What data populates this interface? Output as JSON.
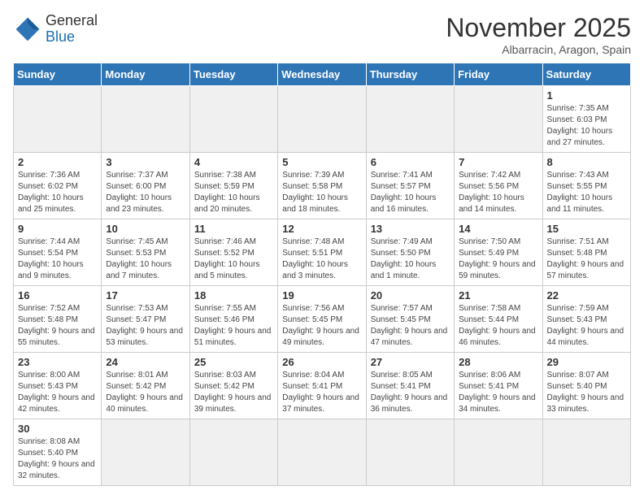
{
  "header": {
    "logo_general": "General",
    "logo_blue": "Blue",
    "month_title": "November 2025",
    "location": "Albarracin, Aragon, Spain"
  },
  "days": [
    "Sunday",
    "Monday",
    "Tuesday",
    "Wednesday",
    "Thursday",
    "Friday",
    "Saturday"
  ],
  "weeks": [
    [
      {
        "date": "",
        "info": "",
        "empty": true
      },
      {
        "date": "",
        "info": "",
        "empty": true
      },
      {
        "date": "",
        "info": "",
        "empty": true
      },
      {
        "date": "",
        "info": "",
        "empty": true
      },
      {
        "date": "",
        "info": "",
        "empty": true
      },
      {
        "date": "",
        "info": "",
        "empty": true
      },
      {
        "date": "1",
        "info": "Sunrise: 7:35 AM\nSunset: 6:03 PM\nDaylight: 10 hours and 27 minutes."
      }
    ],
    [
      {
        "date": "2",
        "info": "Sunrise: 7:36 AM\nSunset: 6:02 PM\nDaylight: 10 hours and 25 minutes."
      },
      {
        "date": "3",
        "info": "Sunrise: 7:37 AM\nSunset: 6:00 PM\nDaylight: 10 hours and 23 minutes."
      },
      {
        "date": "4",
        "info": "Sunrise: 7:38 AM\nSunset: 5:59 PM\nDaylight: 10 hours and 20 minutes."
      },
      {
        "date": "5",
        "info": "Sunrise: 7:39 AM\nSunset: 5:58 PM\nDaylight: 10 hours and 18 minutes."
      },
      {
        "date": "6",
        "info": "Sunrise: 7:41 AM\nSunset: 5:57 PM\nDaylight: 10 hours and 16 minutes."
      },
      {
        "date": "7",
        "info": "Sunrise: 7:42 AM\nSunset: 5:56 PM\nDaylight: 10 hours and 14 minutes."
      },
      {
        "date": "8",
        "info": "Sunrise: 7:43 AM\nSunset: 5:55 PM\nDaylight: 10 hours and 11 minutes."
      }
    ],
    [
      {
        "date": "9",
        "info": "Sunrise: 7:44 AM\nSunset: 5:54 PM\nDaylight: 10 hours and 9 minutes."
      },
      {
        "date": "10",
        "info": "Sunrise: 7:45 AM\nSunset: 5:53 PM\nDaylight: 10 hours and 7 minutes."
      },
      {
        "date": "11",
        "info": "Sunrise: 7:46 AM\nSunset: 5:52 PM\nDaylight: 10 hours and 5 minutes."
      },
      {
        "date": "12",
        "info": "Sunrise: 7:48 AM\nSunset: 5:51 PM\nDaylight: 10 hours and 3 minutes."
      },
      {
        "date": "13",
        "info": "Sunrise: 7:49 AM\nSunset: 5:50 PM\nDaylight: 10 hours and 1 minute."
      },
      {
        "date": "14",
        "info": "Sunrise: 7:50 AM\nSunset: 5:49 PM\nDaylight: 9 hours and 59 minutes."
      },
      {
        "date": "15",
        "info": "Sunrise: 7:51 AM\nSunset: 5:48 PM\nDaylight: 9 hours and 57 minutes."
      }
    ],
    [
      {
        "date": "16",
        "info": "Sunrise: 7:52 AM\nSunset: 5:48 PM\nDaylight: 9 hours and 55 minutes."
      },
      {
        "date": "17",
        "info": "Sunrise: 7:53 AM\nSunset: 5:47 PM\nDaylight: 9 hours and 53 minutes."
      },
      {
        "date": "18",
        "info": "Sunrise: 7:55 AM\nSunset: 5:46 PM\nDaylight: 9 hours and 51 minutes."
      },
      {
        "date": "19",
        "info": "Sunrise: 7:56 AM\nSunset: 5:45 PM\nDaylight: 9 hours and 49 minutes."
      },
      {
        "date": "20",
        "info": "Sunrise: 7:57 AM\nSunset: 5:45 PM\nDaylight: 9 hours and 47 minutes."
      },
      {
        "date": "21",
        "info": "Sunrise: 7:58 AM\nSunset: 5:44 PM\nDaylight: 9 hours and 46 minutes."
      },
      {
        "date": "22",
        "info": "Sunrise: 7:59 AM\nSunset: 5:43 PM\nDaylight: 9 hours and 44 minutes."
      }
    ],
    [
      {
        "date": "23",
        "info": "Sunrise: 8:00 AM\nSunset: 5:43 PM\nDaylight: 9 hours and 42 minutes."
      },
      {
        "date": "24",
        "info": "Sunrise: 8:01 AM\nSunset: 5:42 PM\nDaylight: 9 hours and 40 minutes."
      },
      {
        "date": "25",
        "info": "Sunrise: 8:03 AM\nSunset: 5:42 PM\nDaylight: 9 hours and 39 minutes."
      },
      {
        "date": "26",
        "info": "Sunrise: 8:04 AM\nSunset: 5:41 PM\nDaylight: 9 hours and 37 minutes."
      },
      {
        "date": "27",
        "info": "Sunrise: 8:05 AM\nSunset: 5:41 PM\nDaylight: 9 hours and 36 minutes."
      },
      {
        "date": "28",
        "info": "Sunrise: 8:06 AM\nSunset: 5:41 PM\nDaylight: 9 hours and 34 minutes."
      },
      {
        "date": "29",
        "info": "Sunrise: 8:07 AM\nSunset: 5:40 PM\nDaylight: 9 hours and 33 minutes."
      }
    ],
    [
      {
        "date": "30",
        "info": "Sunrise: 8:08 AM\nSunset: 5:40 PM\nDaylight: 9 hours and 32 minutes."
      },
      {
        "date": "",
        "info": "",
        "empty": true
      },
      {
        "date": "",
        "info": "",
        "empty": true
      },
      {
        "date": "",
        "info": "",
        "empty": true
      },
      {
        "date": "",
        "info": "",
        "empty": true
      },
      {
        "date": "",
        "info": "",
        "empty": true
      },
      {
        "date": "",
        "info": "",
        "empty": true
      }
    ]
  ]
}
